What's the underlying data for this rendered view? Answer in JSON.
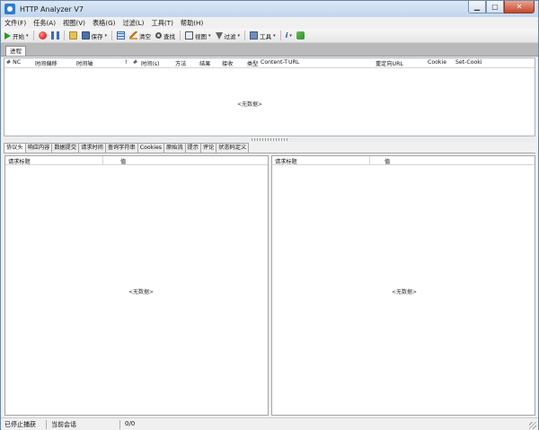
{
  "window": {
    "title": "HTTP Analyzer V7",
    "controls": {
      "minimize": "▁",
      "maximize": "▢",
      "close": "✕"
    }
  },
  "menu": [
    "文件(F)",
    "任务(A)",
    "视图(V)",
    "表格(G)",
    "过滤(L)",
    "工具(T)",
    "帮助(H)"
  ],
  "toolbar": {
    "start": "开始",
    "save": "保存",
    "clear": "清空",
    "find": "查找",
    "view": "视图",
    "filter": "过滤",
    "tools": "工具",
    "dropdown": "▾"
  },
  "session_tab": "进程",
  "top_columns": [
    "# NC",
    "时间偏移",
    "时间轴",
    "!",
    "#",
    "时间(s)",
    "方法",
    "结果",
    "接收",
    "类型",
    "Content-T",
    "URL",
    "重定向URL",
    "Cookie",
    "Set-Cooki"
  ],
  "empty_text": "<无数据>",
  "detail_tabs": [
    "协议头",
    "响应内容",
    "数据提交",
    "请求时间",
    "查询字符串",
    "Cookies",
    "原始流",
    "提示",
    "评论",
    "状态码定义"
  ],
  "detail_pane": {
    "col_header": "请求标题",
    "col_value": "值"
  },
  "status": {
    "capture": "已停止捕获",
    "session": "当前会话",
    "count": "0/0"
  },
  "colors": {
    "title_bar": "#c1d5ec",
    "band": "#b9b9b9",
    "close_button": "#c7472c"
  }
}
